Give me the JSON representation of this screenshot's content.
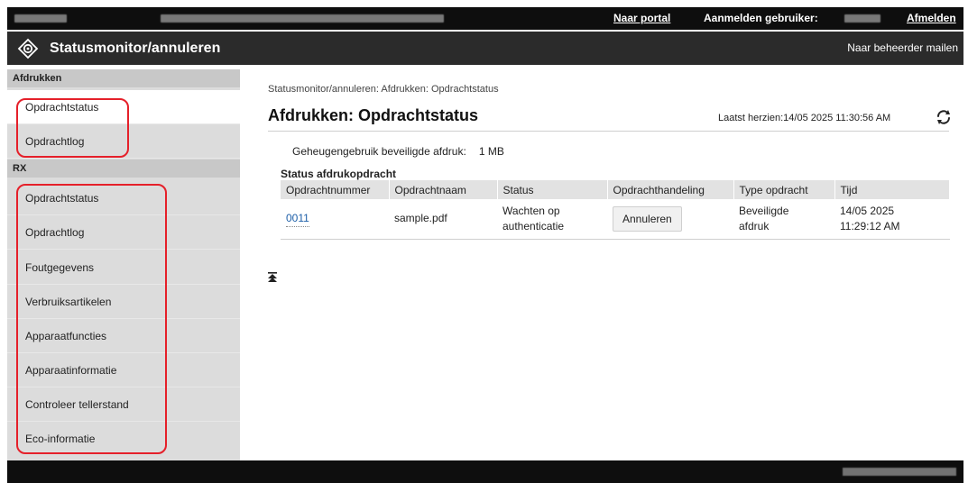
{
  "topbar": {
    "portal_link": "Naar portal",
    "login_user_label": "Aanmelden gebruiker:",
    "logout_link": "Afmelden"
  },
  "titlebar": {
    "app_title": "Statusmonitor/annuleren",
    "mail_admin_link": "Naar beheerder mailen",
    "logo_icon": "device-logo-icon"
  },
  "sidebar": {
    "sections": [
      {
        "heading": "Afdrukken",
        "items": [
          "Opdrachtstatus",
          "Opdrachtlog"
        ]
      },
      {
        "heading": "RX",
        "items": [
          "Opdrachtstatus",
          "Opdrachtlog"
        ]
      }
    ],
    "other_items": [
      "Foutgegevens",
      "Verbruiksartikelen",
      "Apparaatfuncties",
      "Apparaatinformatie",
      "Controleer tellerstand",
      "Eco-informatie"
    ],
    "active_item": "Afdrukken / Opdrachtstatus"
  },
  "main": {
    "breadcrumb": "Statusmonitor/annuleren: Afdrukken: Opdrachtstatus",
    "title": "Afdrukken: Opdrachtstatus",
    "last_updated": "Laatst herzien:14/05 2025 11:30:56 AM",
    "memory_label": "Geheugengebruik beveiligde afdruk:",
    "memory_value": "1 MB",
    "section_title": "Status afdrukopdracht",
    "table": {
      "headers": [
        "Opdrachtnummer",
        "Opdrachtnaam",
        "Status",
        "Opdrachthandeling",
        "Type opdracht",
        "Tijd"
      ],
      "rows": [
        {
          "number": "0011",
          "name": "sample.pdf",
          "status_line1": "Wachten op",
          "status_line2": "authenticatie",
          "action": "Annuleren",
          "type_line1": "Beveiligde",
          "type_line2": "afdruk",
          "time_line1": "14/05 2025",
          "time_line2": "11:29:12 AM"
        }
      ]
    }
  },
  "colors": {
    "highlight": "#e5202a",
    "link": "#1d5fa8",
    "sidebar_bg": "#dcdcdc"
  }
}
